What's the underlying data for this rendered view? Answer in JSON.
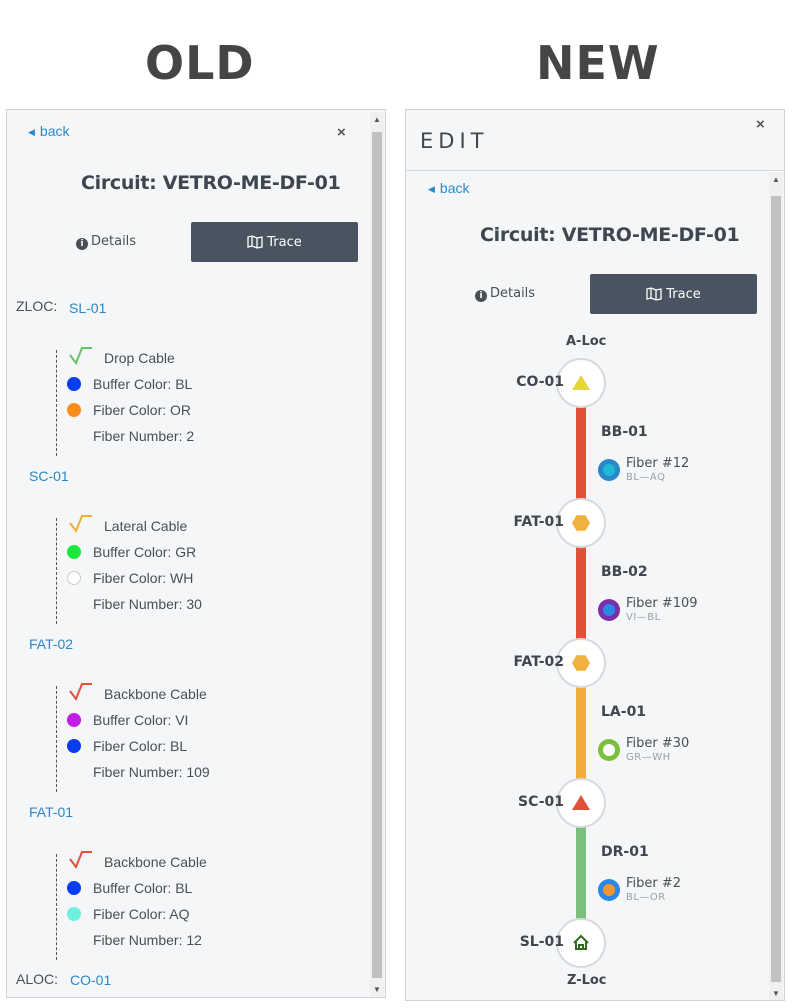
{
  "headings": {
    "old": "OLD",
    "new": "NEW"
  },
  "old_panel": {
    "back_label": "back",
    "close_label": "×",
    "circuit_title": "Circuit: VETRO-ME-DF-01",
    "tabs": {
      "details": "Details",
      "trace": "Trace"
    },
    "zloc_label": "ZLOC:",
    "zloc_value": "SL-01",
    "aloc_label": "ALOC:",
    "aloc_value": "CO-01",
    "groups": [
      {
        "node": "SL-01",
        "cable": "Drop Cable",
        "cable_icon": "cable-corner-icon",
        "cable_color": "#6abf69",
        "buffer": "Buffer Color: BL",
        "buffer_color": "#0b3df0",
        "fiber": "Fiber Color: OR",
        "fiber_color": "#ff8c1a",
        "number": "Fiber Number: 2"
      },
      {
        "node": "SC-01",
        "cable": "Lateral Cable",
        "cable_icon": "cable-corner-icon",
        "cable_color": "#f0ad3c",
        "buffer": "Buffer Color: GR",
        "buffer_color": "#1ee63c",
        "fiber": "Fiber Color: WH",
        "fiber_color": "#ffffff",
        "number": "Fiber Number: 30"
      },
      {
        "node": "FAT-02",
        "cable": "Backbone Cable",
        "cable_icon": "cable-corner-icon",
        "cable_color": "#e2503a",
        "buffer": "Buffer Color: VI",
        "buffer_color": "#c21ee6",
        "fiber": "Fiber Color: BL",
        "fiber_color": "#0b3df0",
        "number": "Fiber Number: 109"
      },
      {
        "node": "FAT-01",
        "cable": "Backbone Cable",
        "cable_icon": "cable-corner-icon",
        "cable_color": "#e2503a",
        "buffer": "Buffer Color: BL",
        "buffer_color": "#0b3df0",
        "fiber": "Fiber Color: AQ",
        "fiber_color": "#6ef0e0",
        "number": "Fiber Number: 12"
      }
    ]
  },
  "new_panel": {
    "edit_title": "EDIT",
    "close_label": "×",
    "back_label": "back",
    "circuit_title": "Circuit: VETRO-ME-DF-01",
    "tabs": {
      "details": "Details",
      "trace": "Trace"
    },
    "a_loc": "A-Loc",
    "z_loc": "Z-Loc",
    "nodes": [
      {
        "name": "CO-01",
        "icon": "triangle-icon",
        "icon_color": "#e6d53c"
      },
      {
        "name": "FAT-01",
        "icon": "hexagon-icon",
        "icon_color": "#f0b23c"
      },
      {
        "name": "FAT-02",
        "icon": "hexagon-icon",
        "icon_color": "#f0b23c"
      },
      {
        "name": "SC-01",
        "icon": "triangle-icon",
        "icon_color": "#e2503a"
      },
      {
        "name": "SL-01",
        "icon": "house-icon",
        "icon_color": "#2e6b1e"
      }
    ],
    "segments": [
      {
        "cable": "BB-01",
        "fiber": "Fiber #12",
        "colors": "BL—AQ",
        "line_color": "#e2503a",
        "ring": "#2b88c8",
        "core": "#1fb8d8"
      },
      {
        "cable": "BB-02",
        "fiber": "Fiber #109",
        "colors": "VI—BL",
        "line_color": "#e2503a",
        "ring": "#7a2fa8",
        "core": "#2b88e8"
      },
      {
        "cable": "LA-01",
        "fiber": "Fiber #30",
        "colors": "GR—WH",
        "line_color": "#f0ad3c",
        "ring": "#7cbf3c",
        "core": "#ffffff"
      },
      {
        "cable": "DR-01",
        "fiber": "Fiber #2",
        "colors": "BL—OR",
        "line_color": "#7cbf7c",
        "ring": "#2b88e8",
        "core": "#f0962e"
      }
    ]
  }
}
